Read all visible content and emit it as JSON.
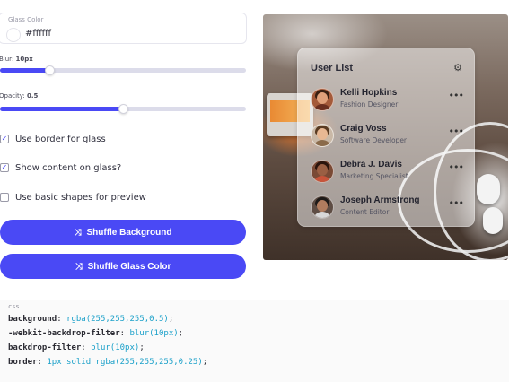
{
  "controls": {
    "glass_color": {
      "label": "Glass Color",
      "value": "#ffffff"
    },
    "blur": {
      "label": "Blur:",
      "value_text": "10px",
      "fraction": 0.2
    },
    "opacity": {
      "label": "Opacity:",
      "value_text": "0.5",
      "fraction": 0.5
    },
    "checkboxes": [
      {
        "label": "Use border for glass",
        "checked": true
      },
      {
        "label": "Show content on glass?",
        "checked": true
      },
      {
        "label": "Use basic shapes for preview",
        "checked": false
      }
    ],
    "shuffle_background_label": "Shuffle Background",
    "shuffle_glass_label": "Shuffle Glass Color",
    "accent_color": "#4a49f5"
  },
  "preview": {
    "card_title": "User List",
    "users": [
      {
        "name": "Kelli Hopkins",
        "role": "Fashion Designer"
      },
      {
        "name": "Craig Voss",
        "role": "Software Developer"
      },
      {
        "name": "Debra J. Davis",
        "role": "Marketing Specialist"
      },
      {
        "name": "Joseph Armstrong",
        "role": "Content Editor"
      }
    ]
  },
  "code": {
    "lang": "css",
    "lines": [
      {
        "prop": "background",
        "value": "rgba(255,255,255,0.5)"
      },
      {
        "prop": "-webkit-backdrop-filter",
        "value": "blur(10px)"
      },
      {
        "prop": "backdrop-filter",
        "value": "blur(10px)"
      },
      {
        "prop": "border",
        "value": "1px solid rgba(255,255,255,0.25)"
      }
    ]
  }
}
